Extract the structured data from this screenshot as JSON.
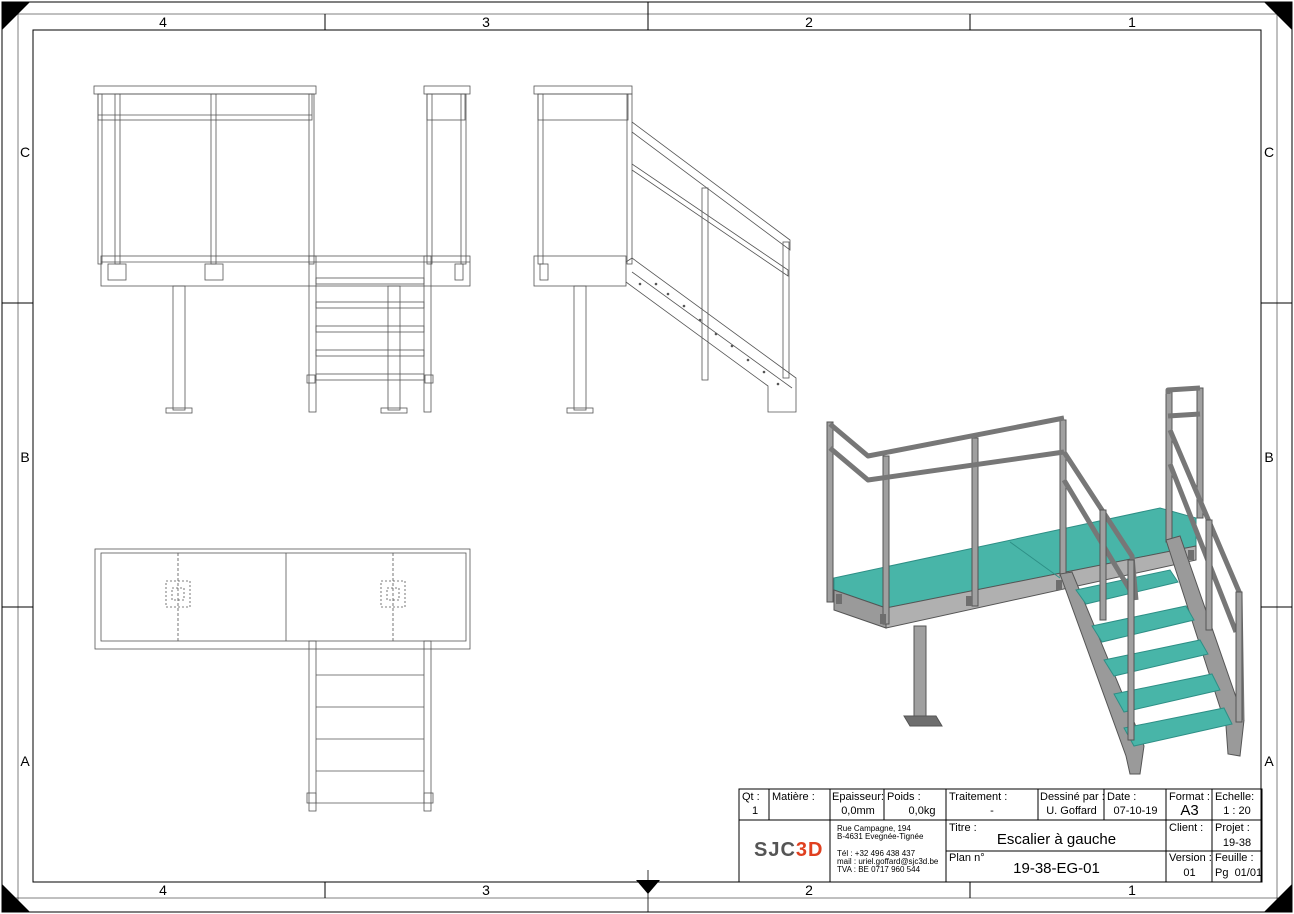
{
  "frame": {
    "columns_top": [
      "4",
      "3",
      "2",
      "1"
    ],
    "columns_bottom": [
      "4",
      "3",
      "2",
      "1"
    ],
    "rows_left": [
      "C",
      "B",
      "A"
    ],
    "rows_right": [
      "C",
      "B",
      "A"
    ]
  },
  "title_block": {
    "qt_label": "Qt :",
    "qt_value": "1",
    "matiere_label": "Matière :",
    "matiere_value": "",
    "epaisseur_label": "Epaisseur:",
    "epaisseur_value": "0,0mm",
    "poids_label": "Poids :",
    "poids_value": "0,0kg",
    "traitement_label": "Traitement :",
    "traitement_value": "-",
    "dessine_label": "Dessiné par :",
    "dessine_value": "U. Goffard",
    "date_label": "Date :",
    "date_value": "07-10-19",
    "format_label": "Format :",
    "format_value": "A3",
    "echelle_label": "Echelle:",
    "echelle_value": "1 : 20",
    "titre_label": "Titre :",
    "titre_value": "Escalier à gauche",
    "client_label": "Client :",
    "client_value": "",
    "projet_label": "Projet :",
    "projet_value": "19-38",
    "plan_label": "Plan n°",
    "plan_value": "19-38-EG-01",
    "version_label": "Version :",
    "version_value": "01",
    "feuille_label": "Feuille :",
    "feuille_value": "Pg  01/01",
    "logo_left": "SJC",
    "logo_right": "3D",
    "address_line1": "Rue Campagne, 194",
    "address_line2": "B-4631 Evegnée-Tignée",
    "tel": "Tél : +32 496 438 437",
    "mail": "mail : uriel.goffard@sjc3d.be",
    "tva": "TVA : BE 0717 960 544"
  },
  "colors": {
    "tread": "#48b5a8",
    "tread_dark": "#2e8f86",
    "steel": "#9a9a9a",
    "steel_dark": "#6e6e6e",
    "line": "#555555"
  }
}
